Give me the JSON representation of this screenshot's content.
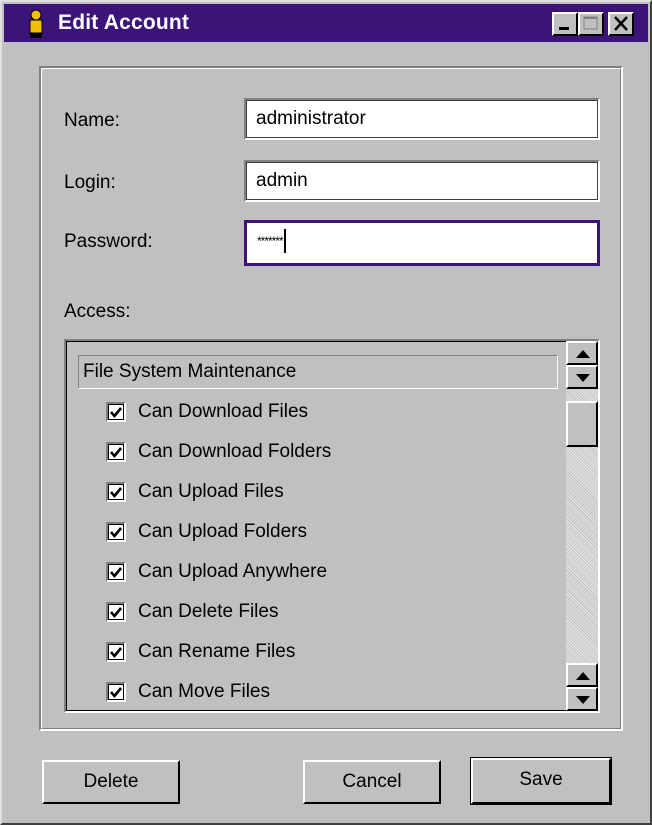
{
  "window": {
    "title": "Edit Account"
  },
  "titlebar_buttons": [
    "minimize-icon",
    "maximize-icon",
    "close-icon"
  ],
  "form": {
    "name_label": "Name:",
    "name_value": "administrator",
    "login_label": "Login:",
    "login_value": "admin",
    "password_label": "Password:",
    "password_masked": "*******",
    "access_label": "Access:"
  },
  "access_list": {
    "header": "File System Maintenance",
    "items": [
      {
        "label": "Can Download Files",
        "checked": true
      },
      {
        "label": "Can Download Folders",
        "checked": true
      },
      {
        "label": "Can Upload Files",
        "checked": true
      },
      {
        "label": "Can Upload Folders",
        "checked": true
      },
      {
        "label": "Can Upload Anywhere",
        "checked": true
      },
      {
        "label": "Can Delete Files",
        "checked": true
      },
      {
        "label": "Can Rename Files",
        "checked": true
      },
      {
        "label": "Can Move Files",
        "checked": true
      }
    ]
  },
  "buttons": {
    "delete": "Delete",
    "cancel": "Cancel",
    "save": "Save"
  },
  "colors": {
    "titlebar": "#3c1478",
    "face": "#c0c0c0",
    "focus": "#3c1478"
  }
}
